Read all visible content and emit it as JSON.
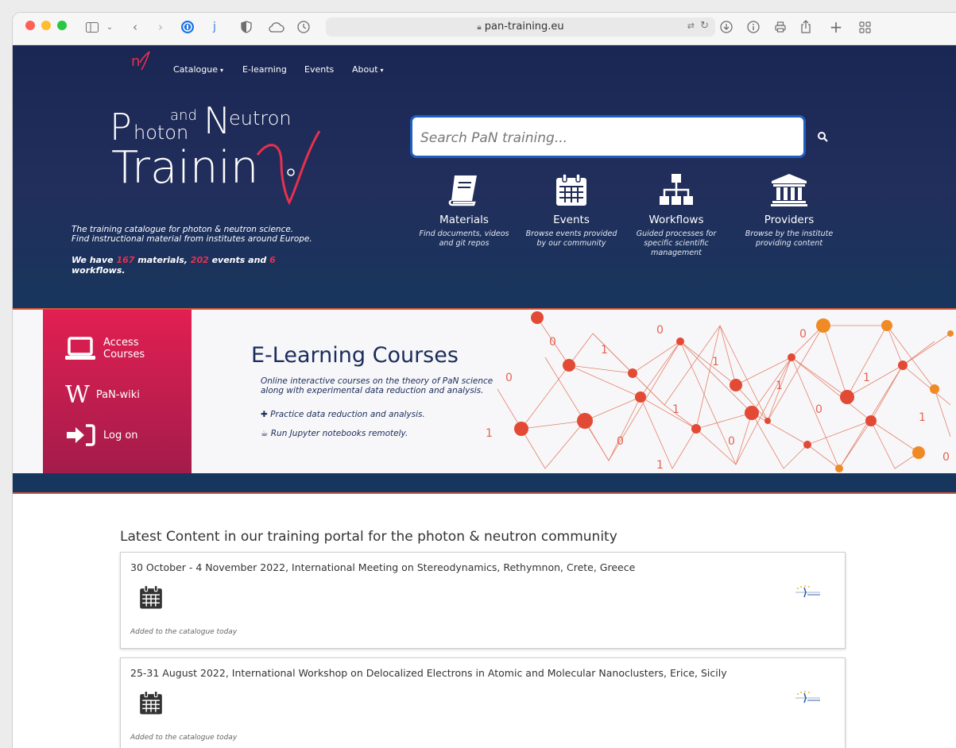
{
  "browser": {
    "url": "pan-training.eu",
    "icons": [
      "sidebar-icon",
      "chevron-down-icon",
      "back-icon",
      "forward-icon",
      "password-manager-icon",
      "j-extension-icon",
      "shield-icon",
      "cloud-icon",
      "clock-icon",
      "translate-icon",
      "reload-icon",
      "download-icon",
      "info-icon",
      "print-icon",
      "share-icon",
      "plus-icon",
      "tab-overview-icon"
    ]
  },
  "nav": {
    "items": [
      {
        "label": "Catalogue",
        "dropdown": true
      },
      {
        "label": "E-learning",
        "dropdown": false
      },
      {
        "label": "Events",
        "dropdown": false
      },
      {
        "label": "About",
        "dropdown": true
      }
    ]
  },
  "logo": {
    "line1_a": "P",
    "line1_b": "hoton",
    "and": "and",
    "neutron_n": "N",
    "neutron_rest": "eutron",
    "training": "Trainin"
  },
  "hero": {
    "tagline_1": "The training catalogue for photon & neutron science.",
    "tagline_2": "Find instructional material from institutes around Europe.",
    "counts_prefix": "We have ",
    "materials_count": "167",
    "materials_label": " materials, ",
    "events_count": "202",
    "events_label": " events and ",
    "workflows_count": "6",
    "workflows_label": " workflows."
  },
  "search": {
    "placeholder": "Search PaN training..."
  },
  "features": [
    {
      "title": "Materials",
      "desc": "Find documents, videos and git repos",
      "icon": "book-icon"
    },
    {
      "title": "Events",
      "desc": "Browse events provided by our community",
      "icon": "calendar-icon"
    },
    {
      "title": "Workflows",
      "desc": "Guided processes for specific scientific management",
      "icon": "sitemap-icon"
    },
    {
      "title": "Providers",
      "desc": "Browse by the institute providing content",
      "icon": "institution-icon"
    }
  ],
  "banner": {
    "side": [
      {
        "label_1": "Access",
        "label_2": "Courses",
        "icon": "laptop-icon"
      },
      {
        "label_1": "PaN-wiki",
        "icon": "wikipedia-icon"
      },
      {
        "label_1": "Log on",
        "icon": "sign-in-icon"
      }
    ],
    "title": "E-Learning Courses",
    "desc": "Online interactive courses on the theory of PaN science along with experimental data reduction and analysis.",
    "bullet_1": "Practice data reduction and analysis.",
    "bullet_2": "Run Jupyter notebooks remotely."
  },
  "latest": {
    "title": "Latest Content in our training portal for the photon & neutron community",
    "items": [
      {
        "title": "30 October - 4 November 2022, International Meeting on Stereodynamics, Rethymnon, Crete, Greece",
        "note": "Added to the catalogue today"
      },
      {
        "title": "25-31 August 2022, International Workshop on Delocalized Electrons in Atomic and Molecular Nanoclusters, Erice, Sicily",
        "note": "Added to the catalogue today"
      }
    ]
  },
  "colors": {
    "hero_bg": "#1f2b57",
    "accent_red": "#e8304f",
    "banner_side": "#d21f50",
    "strip_blue": "#17365d"
  }
}
